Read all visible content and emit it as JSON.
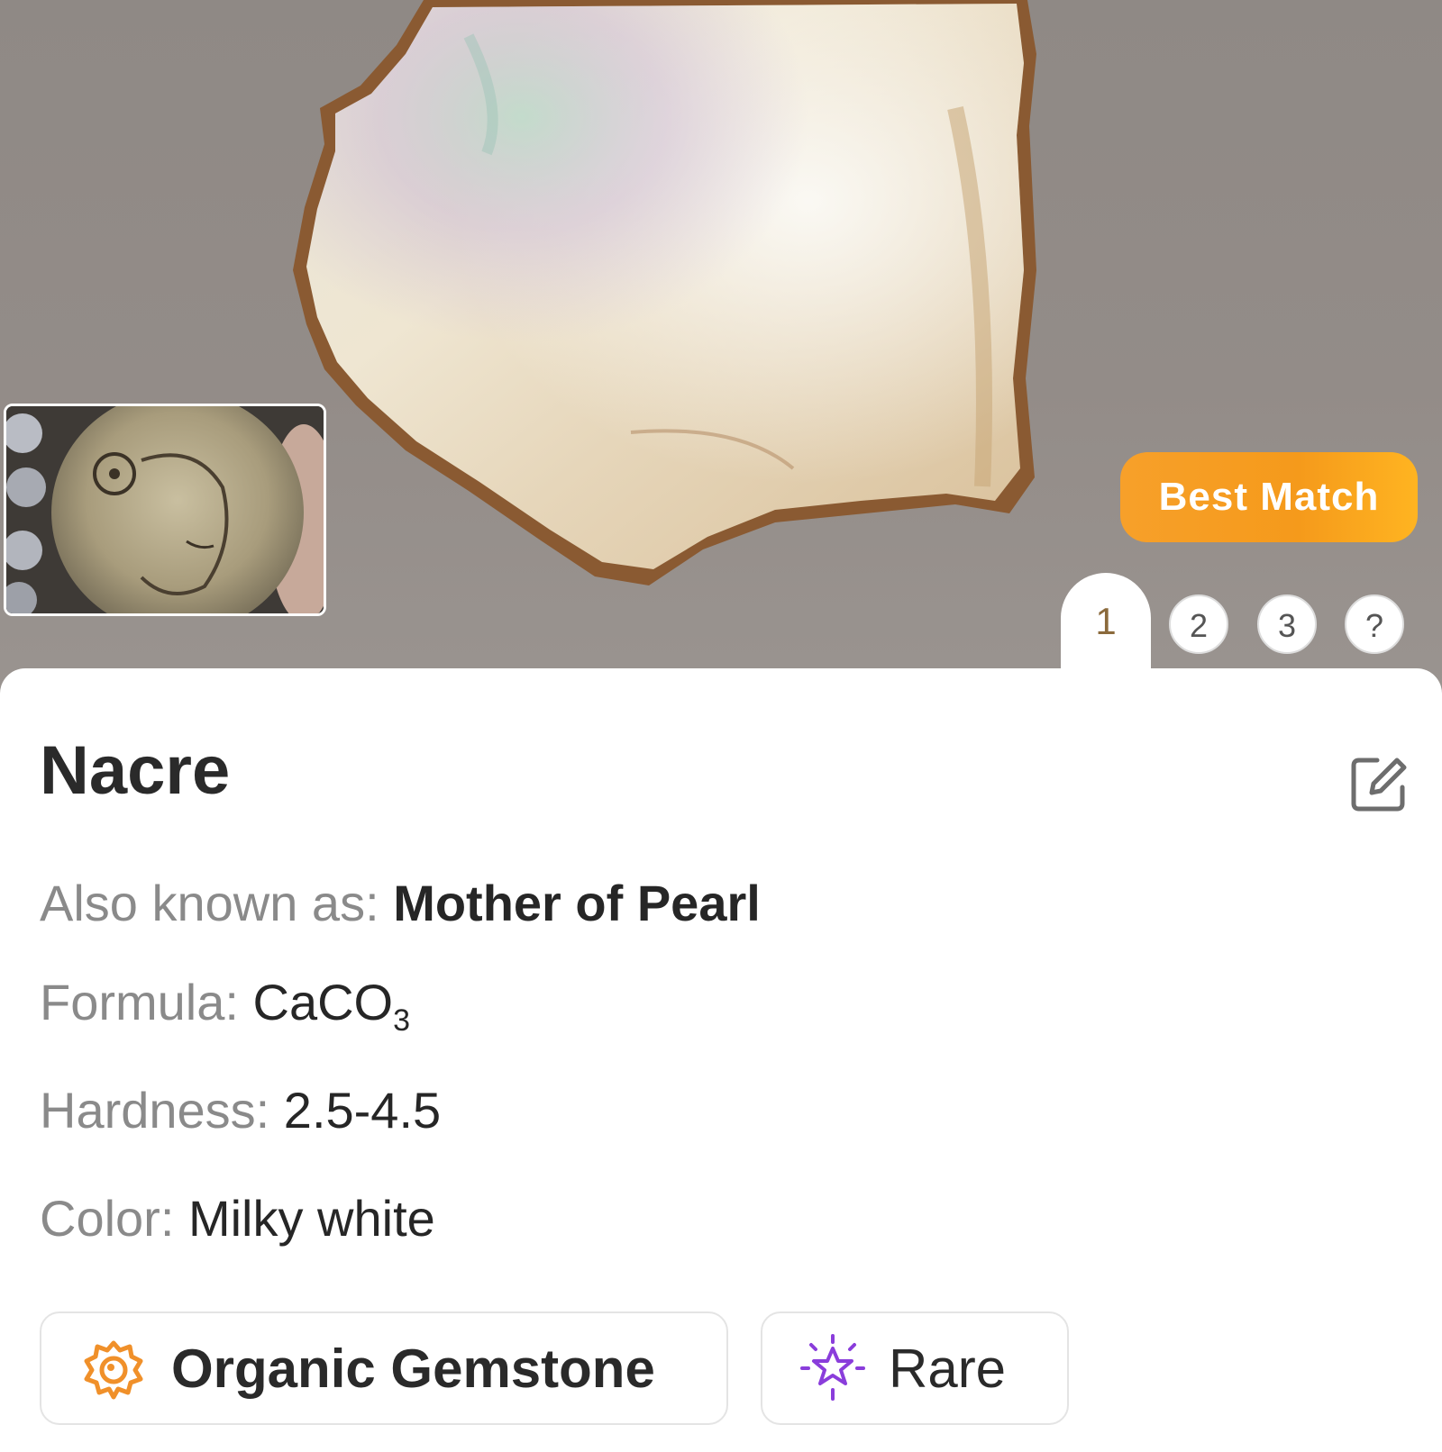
{
  "specimen": {
    "name": "Nacre",
    "badge": "Best Match"
  },
  "pagination": {
    "active": "1",
    "pages": [
      "2",
      "3"
    ],
    "help": "?"
  },
  "properties": {
    "aka_label": "Also known as:",
    "aka_value": "Mother of Pearl",
    "formula_label": "Formula:",
    "formula_value": "CaCO",
    "formula_subscript": "3",
    "hardness_label": "Hardness:",
    "hardness_value": "2.5-4.5",
    "color_label": "Color:",
    "color_value": "Milky white"
  },
  "tags": [
    {
      "label": "Organic Gemstone",
      "icon": "shell-icon",
      "color": "#f0902a"
    },
    {
      "label": "Rare",
      "icon": "sparkle-star-icon",
      "color": "#8a3ddb"
    }
  ],
  "colors": {
    "accent": "#f7a02a",
    "title_text": "#2a2a2a",
    "label_text": "#8a8a8a"
  }
}
